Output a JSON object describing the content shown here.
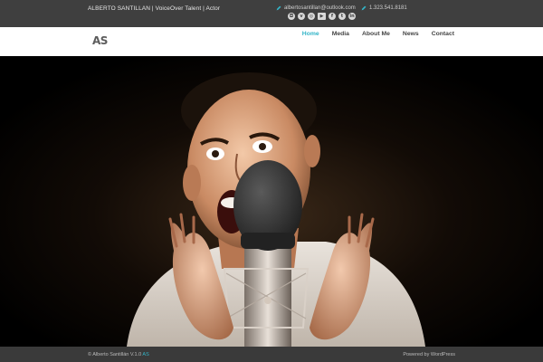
{
  "topbar": {
    "tagline": "ALBERTO SANTILLAN | VoiceOver Talent | Actor",
    "email": "albertosantillan@outlook.com",
    "phone": "1.323.541.8181",
    "socials": [
      {
        "icon": "instagram-icon",
        "glyph": "◘"
      },
      {
        "icon": "vimeo-icon",
        "glyph": "v"
      },
      {
        "icon": "dribbble-icon",
        "glyph": "◎"
      },
      {
        "icon": "youtube-icon",
        "glyph": "▶"
      },
      {
        "icon": "facebook-icon",
        "glyph": "f"
      },
      {
        "icon": "twitter-icon",
        "glyph": "t"
      },
      {
        "icon": "linkedin-icon",
        "glyph": "in"
      }
    ]
  },
  "header": {
    "logo": "AS",
    "nav": [
      "Home",
      "Media",
      "About Me",
      "News",
      "Contact"
    ],
    "active_nav": "Home"
  },
  "footer": {
    "copyright_prefix": "© Alberto Santillán V.1.0 ",
    "copyright_accent": "AS",
    "powered": "Powered by WordPress"
  },
  "colors": {
    "accent": "#33b5c8",
    "topbar_bg": "#3f3f3f",
    "footer_bg": "#3a3a3a"
  }
}
